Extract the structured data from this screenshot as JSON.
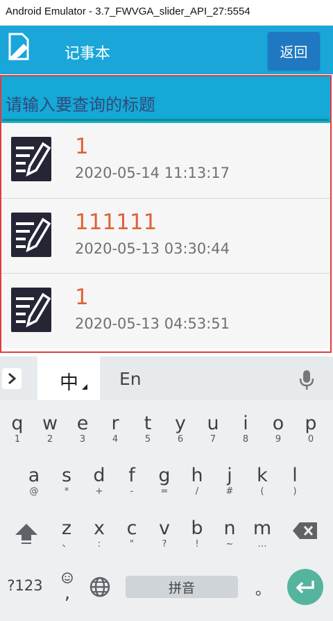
{
  "window": {
    "title": "Android Emulator - 3.7_FWVGA_slider_API_27:5554"
  },
  "appbar": {
    "title": "记事本",
    "back_label": "返回",
    "icon": "note-edit-icon"
  },
  "search": {
    "placeholder": "请输入要查询的标题"
  },
  "notes": [
    {
      "title": "1",
      "time": "2020-05-14 11:13:17",
      "icon": "note-pencil-icon"
    },
    {
      "title": "111111",
      "time": "2020-05-13 03:30:44",
      "icon": "note-pencil-icon"
    },
    {
      "title": "1",
      "time": "2020-05-13 04:53:51",
      "icon": "note-pencil-icon"
    }
  ],
  "keyboard": {
    "zh_label": "中",
    "en_label": "En",
    "row1": [
      {
        "m": "q",
        "s": "1"
      },
      {
        "m": "w",
        "s": "2"
      },
      {
        "m": "e",
        "s": "3"
      },
      {
        "m": "r",
        "s": "4"
      },
      {
        "m": "t",
        "s": "5"
      },
      {
        "m": "y",
        "s": "6"
      },
      {
        "m": "u",
        "s": "7"
      },
      {
        "m": "i",
        "s": "8"
      },
      {
        "m": "o",
        "s": "9"
      },
      {
        "m": "p",
        "s": "0"
      }
    ],
    "row2": [
      {
        "m": "a",
        "s": "@"
      },
      {
        "m": "s",
        "s": "*"
      },
      {
        "m": "d",
        "s": "+"
      },
      {
        "m": "f",
        "s": "-"
      },
      {
        "m": "g",
        "s": "="
      },
      {
        "m": "h",
        "s": "/"
      },
      {
        "m": "j",
        "s": "#"
      },
      {
        "m": "k",
        "s": "("
      },
      {
        "m": "l",
        "s": ")"
      }
    ],
    "row3": [
      {
        "m": "z",
        "s": "、"
      },
      {
        "m": "x",
        "s": ":"
      },
      {
        "m": "c",
        "s": "\""
      },
      {
        "m": "v",
        "s": "?"
      },
      {
        "m": "b",
        "s": "!"
      },
      {
        "m": "n",
        "s": "~"
      },
      {
        "m": "m",
        "s": "…"
      }
    ],
    "symbols_label": "?123",
    "emoji_comma": ",",
    "space_label": "拼音",
    "period_label": "。"
  },
  "colors": {
    "appbar": "#1aa6d8",
    "back_button": "#1f78c1",
    "note_title": "#e0623a",
    "frame": "#e03c3c",
    "enter": "#55b49d"
  }
}
